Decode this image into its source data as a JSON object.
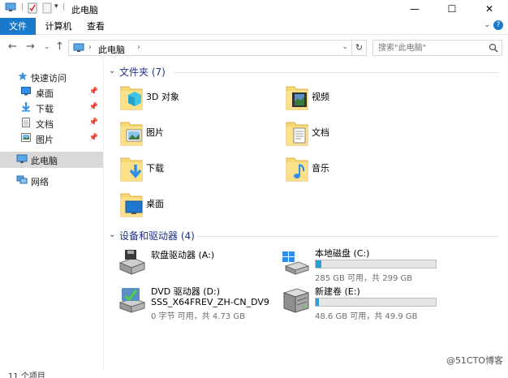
{
  "window": {
    "title": "此电脑",
    "minimize_glyph": "—",
    "maximize_glyph": "☐",
    "close_glyph": "✕"
  },
  "ribbon": {
    "tabs": [
      {
        "label": "文件",
        "active": true
      },
      {
        "label": "计算机",
        "active": false
      },
      {
        "label": "查看",
        "active": false
      }
    ],
    "accent": "#1979ca"
  },
  "address": {
    "path_label": "此电脑",
    "separator": "›",
    "search_placeholder": "搜索\"此电脑\""
  },
  "nav": {
    "quick_access_label": "快速访问",
    "quick_items": [
      {
        "label": "桌面",
        "icon": "desktop-icon",
        "pinned": true
      },
      {
        "label": "下载",
        "icon": "download-icon",
        "pinned": true
      },
      {
        "label": "文档",
        "icon": "document-icon",
        "pinned": true
      },
      {
        "label": "图片",
        "icon": "picture-icon",
        "pinned": true
      }
    ],
    "this_pc_label": "此电脑",
    "network_label": "网络"
  },
  "folders_group": {
    "header": "文件夹 (7)",
    "items": [
      {
        "label": "3D 对象",
        "icon": "3d-objects-folder-icon"
      },
      {
        "label": "视频",
        "icon": "videos-folder-icon"
      },
      {
        "label": "图片",
        "icon": "pictures-folder-icon"
      },
      {
        "label": "文档",
        "icon": "documents-folder-icon"
      },
      {
        "label": "下载",
        "icon": "downloads-folder-icon"
      },
      {
        "label": "音乐",
        "icon": "music-folder-icon"
      },
      {
        "label": "桌面",
        "icon": "desktop-folder-icon"
      }
    ]
  },
  "drives_group": {
    "header": "设备和驱动器 (4)",
    "items": [
      {
        "name": "软盘驱动器 (A:)",
        "icon": "floppy-drive-icon",
        "info": "",
        "subname": "",
        "used_fraction": null
      },
      {
        "name": "本地磁盘 (C:)",
        "icon": "windows-drive-icon",
        "info": "285 GB 可用，共 299 GB",
        "subname": "",
        "used_fraction": 0.05
      },
      {
        "name": "DVD 驱动器 (D:)",
        "icon": "dvd-drive-icon",
        "subname": "SSS_X64FREV_ZH-CN_DV9",
        "info": "0 字节 可用，共 4.73 GB",
        "used_fraction": null
      },
      {
        "name": "新建卷 (E:)",
        "icon": "hard-drive-icon",
        "info": "48.6 GB 可用，共 49.9 GB",
        "subname": "",
        "used_fraction": 0.03
      }
    ]
  },
  "status": {
    "item_count": "11 个项目",
    "watermark": "@51CTO博客"
  }
}
